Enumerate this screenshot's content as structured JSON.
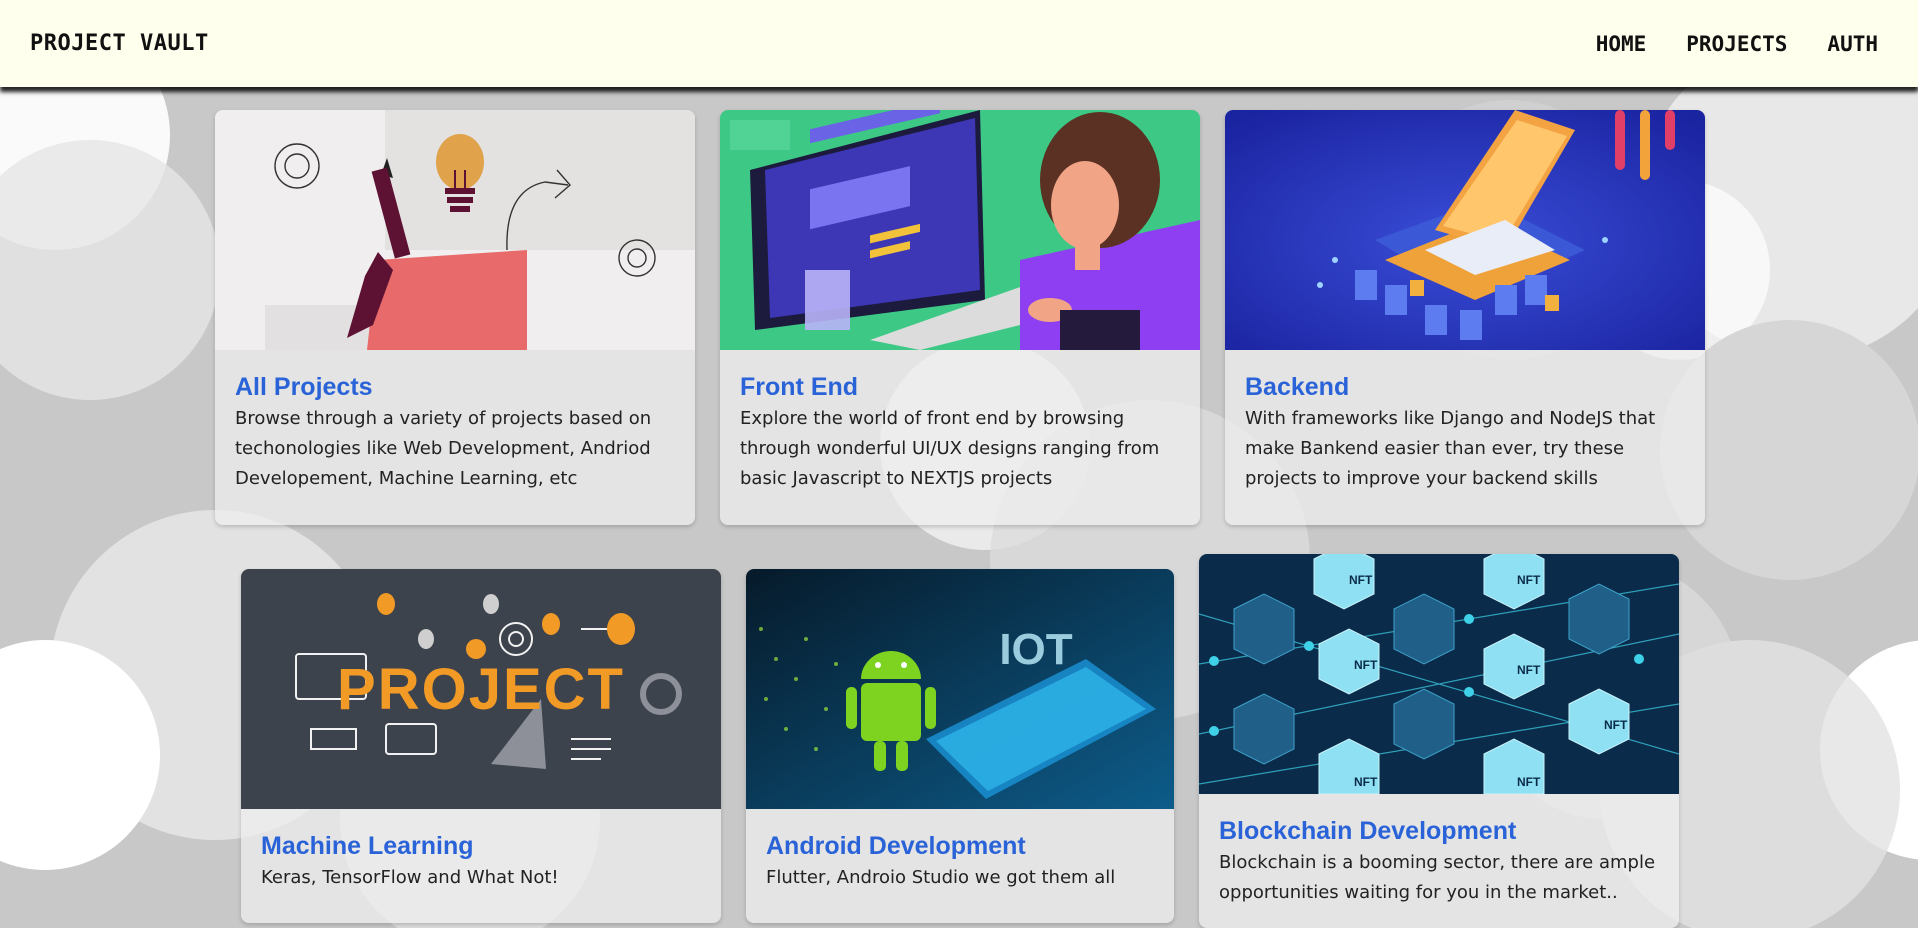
{
  "navbar": {
    "brand": "PROJECT VAULT",
    "links": [
      "HOME",
      "PROJECTS",
      "AUTH"
    ]
  },
  "cards": [
    {
      "title": "All Projects",
      "text": "Browse through a variety of projects based on techonologies like Web Development, Andriod Developement, Machine Learning, etc",
      "image": "creative-ideas-illustration"
    },
    {
      "title": "Front End",
      "text": "Explore the world of front end by browsing through wonderful UI/UX designs ranging from basic Javascript to NEXTJS projects",
      "image": "developer-at-computer-illustration"
    },
    {
      "title": "Backend",
      "text": "With frameworks like Django and NodeJS that make Bankend easier than ever, try these projects to improve your backend skills",
      "image": "isometric-server-laptop-illustration"
    },
    {
      "title": "Machine Learning",
      "text": "Keras, TensorFlow and What Not!",
      "image": "project-icons-illustration"
    },
    {
      "title": "Android Development",
      "text": "Flutter, Androio Studio we got them all",
      "image": "android-iot-illustration"
    },
    {
      "title": "Blockchain Development",
      "text": "Blockchain is a booming sector, there are ample opportunities waiting for you in the market..",
      "image": "nft-blockchain-illustration"
    }
  ],
  "image_text": {
    "ml_word": "PROJECT",
    "iot_word": "IOT",
    "nft_label": "NFT"
  },
  "colors": {
    "navbar_bg": "#ffffed",
    "title_blue": "#2a63d8",
    "card_bg": "#eeeeee"
  }
}
